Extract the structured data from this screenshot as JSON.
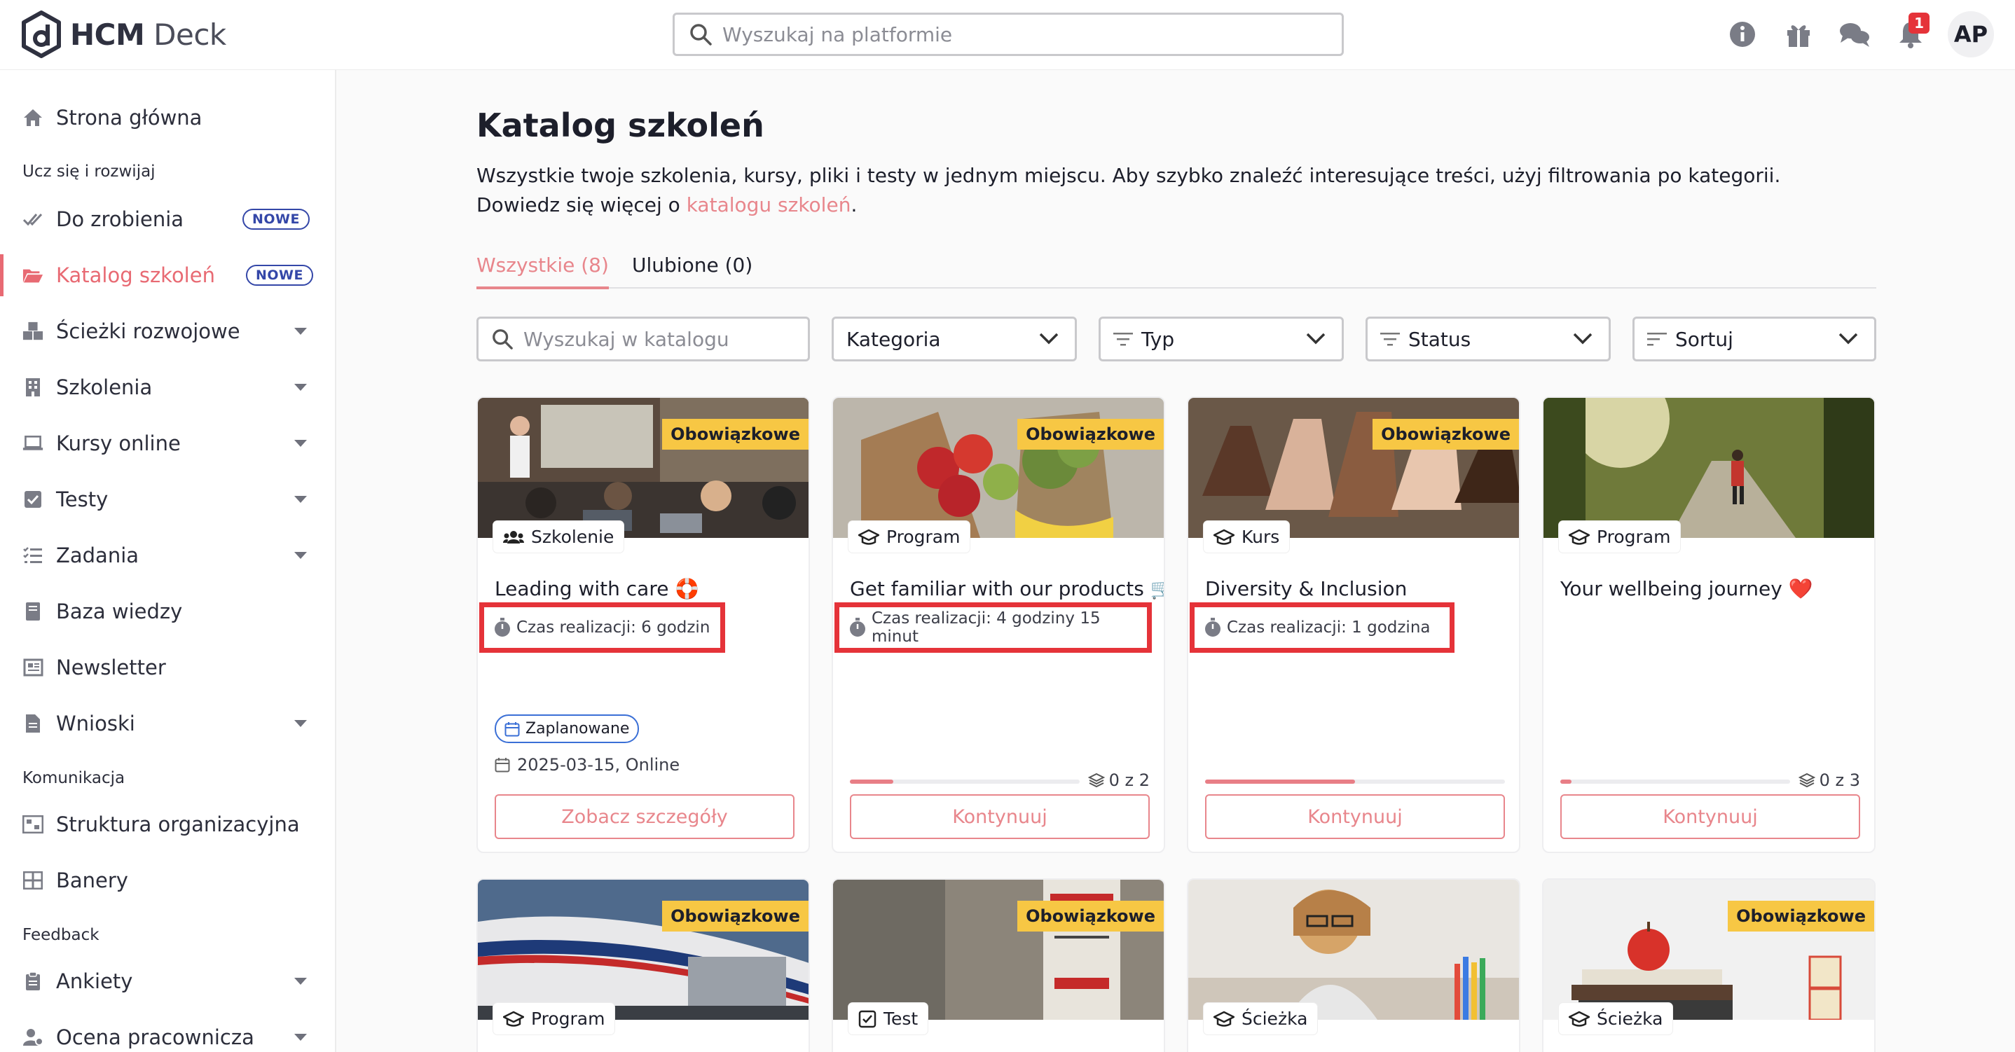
{
  "app": {
    "brand_bold": "HCM",
    "brand_light": " Deck",
    "logo_icon": "hcm-deck-logo"
  },
  "header": {
    "search_placeholder": "Wyszukaj na platformie",
    "notifications_count": "1",
    "avatar_initials": "AP",
    "icons": [
      "info-icon",
      "gift-icon",
      "chat-icon",
      "bell-icon"
    ]
  },
  "sidebar": {
    "home": "Strona główna",
    "section_learn": "Ucz się i rozwijaj",
    "items_learn": [
      {
        "label": "Do zrobienia",
        "badge": "NOWE"
      },
      {
        "label": "Katalog szkoleń",
        "badge": "NOWE",
        "active": true
      },
      {
        "label": "Ścieżki rozwojowe"
      },
      {
        "label": "Szkolenia"
      },
      {
        "label": "Kursy online"
      },
      {
        "label": "Testy"
      },
      {
        "label": "Zadania"
      },
      {
        "label": "Baza wiedzy"
      },
      {
        "label": "Newsletter"
      },
      {
        "label": "Wnioski"
      }
    ],
    "section_comm": "Komunikacja",
    "items_comm": [
      {
        "label": "Struktura organizacyjna"
      },
      {
        "label": "Banery"
      }
    ],
    "section_feedback": "Feedback",
    "items_feedback": [
      {
        "label": "Ankiety"
      },
      {
        "label": "Ocena pracownicza"
      }
    ]
  },
  "page": {
    "title": "Katalog szkoleń",
    "description": "Wszystkie twoje szkolenia, kursy, pliki i testy w jednym miejscu. Aby szybko znaleźć interesujące treści, użyj filtrowania po kategorii. Dowiedz się więcej o ",
    "description_link": "katalogu szkoleń",
    "description_end": ".",
    "tabs": [
      {
        "label": "Wszystkie (8)",
        "active": true
      },
      {
        "label": "Ulubione (0)"
      }
    ],
    "filters": {
      "search_placeholder": "Wyszukaj w katalogu",
      "category": "Kategoria",
      "type": "Typ",
      "status": "Status",
      "sort": "Sortuj"
    }
  },
  "cards": [
    {
      "title": "Leading with care 🛟",
      "type": "Szkolenie",
      "mandatory": "Obowiązkowe",
      "duration": "Czas realizacji: 6 godzin",
      "status": "Zaplanowane",
      "date": "2025-03-15, Online",
      "button": "Zobacz szczegóły"
    },
    {
      "title": "Get familiar with our products 🛒",
      "type": "Program",
      "mandatory": "Obowiązkowe",
      "duration": "Czas realizacji: 4 godziny 15 minut",
      "progress_label": "0 z 2",
      "progress": 0.19,
      "button": "Kontynuuj"
    },
    {
      "title": "Diversity & Inclusion",
      "type": "Kurs",
      "mandatory": "Obowiązkowe",
      "duration": "Czas realizacji: 1 godzina",
      "progress": 0.5,
      "button": "Kontynuuj"
    },
    {
      "title": "Your wellbeing journey ❤️",
      "type": "Program",
      "progress_label": "0 z 3",
      "progress": 0.05,
      "button": "Kontynuuj"
    },
    {
      "type": "Program",
      "mandatory": "Obowiązkowe"
    },
    {
      "type": "Test",
      "mandatory": "Obowiązkowe"
    },
    {
      "type": "Ścieżka"
    },
    {
      "type": "Ścieżka",
      "mandatory": "Obowiązkowe"
    }
  ],
  "colors": {
    "accent": "#e8868c",
    "mandatory": "#f7c744",
    "highlight": "#e53339",
    "nowe": "#3447a8"
  }
}
